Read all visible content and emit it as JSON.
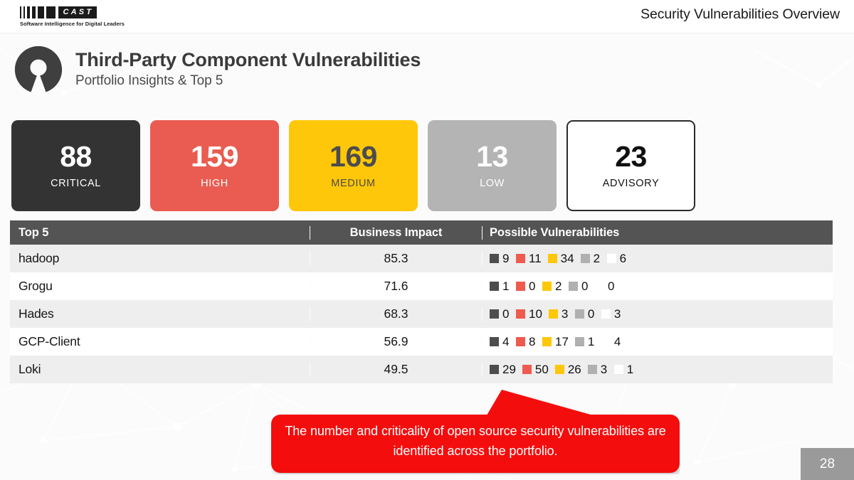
{
  "header": {
    "logo_word": "CAST",
    "logo_tagline": "Software Intelligence for Digital Leaders",
    "title": "Security Vulnerabilities Overview"
  },
  "title_block": {
    "icon": "open-source-icon",
    "title": "Third-Party Component Vulnerabilities",
    "subtitle": "Portfolio Insights & Top 5"
  },
  "kpis": [
    {
      "value": "88",
      "label": "CRITICAL",
      "bg": "#333333",
      "fg": "#ffffff"
    },
    {
      "value": "159",
      "label": "HIGH",
      "bg": "#ea5c51",
      "fg": "#ffffff"
    },
    {
      "value": "169",
      "label": "MEDIUM",
      "bg": "#ffc709",
      "fg": "#4c4c4c"
    },
    {
      "value": "13",
      "label": "LOW",
      "bg": "#b4b4b4",
      "fg": "#ffffff"
    },
    {
      "value": "23",
      "label": "ADVISORY",
      "bg": "#ffffff",
      "fg": "#111111"
    }
  ],
  "table": {
    "columns": [
      "Top 5",
      "Business Impact",
      "Possible Vulnerabilities"
    ],
    "severity_order": [
      "critical",
      "high",
      "medium",
      "low",
      "advisory"
    ],
    "severity_colors": {
      "critical": "#4d4d4d",
      "high": "#ee5b4e",
      "medium": "#ffc709",
      "low": "#b0b0b0",
      "advisory": "#ffffff"
    },
    "rows": [
      {
        "name": "hadoop",
        "impact": "85.3",
        "vulns": [
          "9",
          "11",
          "34",
          "2",
          "6"
        ]
      },
      {
        "name": "Grogu",
        "impact": "71.6",
        "vulns": [
          "1",
          "0",
          "2",
          "0",
          "0"
        ]
      },
      {
        "name": "Hades",
        "impact": "68.3",
        "vulns": [
          "0",
          "10",
          "3",
          "0",
          "3"
        ]
      },
      {
        "name": "GCP-Client",
        "impact": "56.9",
        "vulns": [
          "4",
          "8",
          "17",
          "1",
          "4"
        ]
      },
      {
        "name": "Loki",
        "impact": "49.5",
        "vulns": [
          "29",
          "50",
          "26",
          "3",
          "1"
        ]
      }
    ]
  },
  "callout": {
    "text": "The number and criticality of open source security vulnerabilities are identified across the portfolio.",
    "color": "#f40a0a"
  },
  "page_number": "28"
}
